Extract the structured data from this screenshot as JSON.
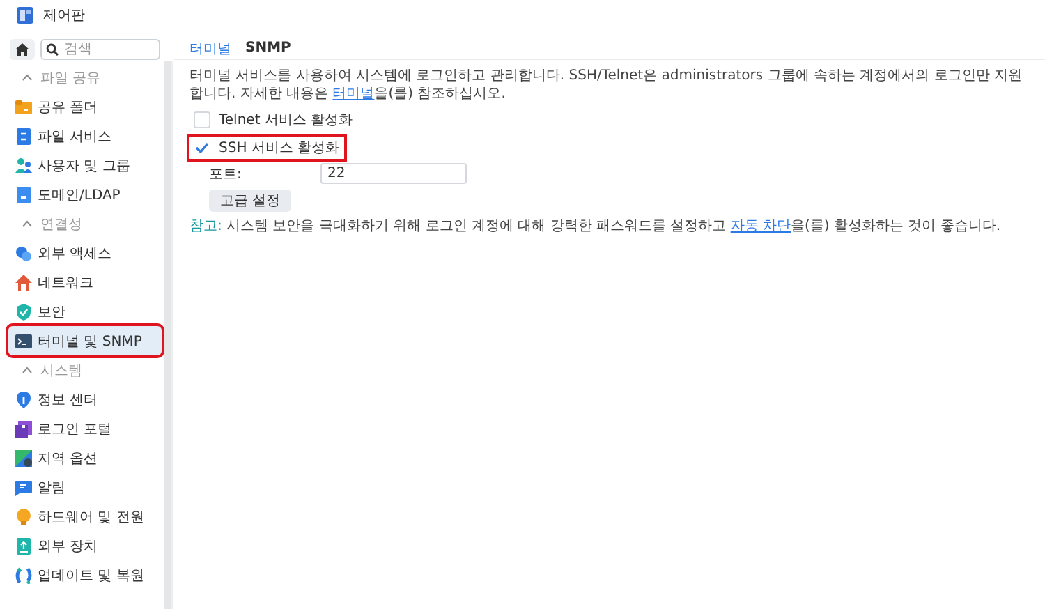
{
  "window": {
    "title": "제어판"
  },
  "sidebar": {
    "search": {
      "placeholder": "검색"
    },
    "sections": [
      {
        "title": "파일 공유",
        "expanded": true,
        "items": [
          {
            "label": "공유 폴더",
            "selected": false,
            "highlighted": false
          },
          {
            "label": "파일 서비스",
            "selected": false,
            "highlighted": false
          },
          {
            "label": "사용자 및 그룹",
            "selected": false,
            "highlighted": false
          },
          {
            "label": "도메인/LDAP",
            "selected": false,
            "highlighted": false
          }
        ]
      },
      {
        "title": "연결성",
        "expanded": true,
        "items": [
          {
            "label": "외부 액세스",
            "selected": false,
            "highlighted": false
          },
          {
            "label": "네트워크",
            "selected": false,
            "highlighted": false
          },
          {
            "label": "보안",
            "selected": false,
            "highlighted": false
          },
          {
            "label": "터미널 및 SNMP",
            "selected": true,
            "highlighted": true
          }
        ]
      },
      {
        "title": "시스템",
        "expanded": true,
        "items": [
          {
            "label": "정보 센터",
            "selected": false,
            "highlighted": false
          },
          {
            "label": "로그인 포털",
            "selected": false,
            "highlighted": false
          },
          {
            "label": "지역 옵션",
            "selected": false,
            "highlighted": false
          },
          {
            "label": "알림",
            "selected": false,
            "highlighted": false
          },
          {
            "label": "하드웨어 및 전원",
            "selected": false,
            "highlighted": false
          },
          {
            "label": "외부 장치",
            "selected": false,
            "highlighted": false
          },
          {
            "label": "업데이트 및 복원",
            "selected": false,
            "highlighted": false
          }
        ]
      }
    ]
  },
  "tabs": [
    {
      "label": "터미널",
      "selected": true
    },
    {
      "label": "SNMP",
      "selected": false
    }
  ],
  "description": {
    "before": "터미널 서비스를 사용하여 시스템에 로그인하고 관리합니다. SSH/Telnet은 administrators 그룹에 속하는 계정에서의 로그인만 지원합니다. 자세한 내용은 ",
    "link": "터미널",
    "after": "을(를) 참조하십시오."
  },
  "options": [
    {
      "label": "Telnet 서비스 활성화",
      "checked": false,
      "highlighted": false
    },
    {
      "label": "SSH 서비스 활성화",
      "checked": true,
      "highlighted": true
    }
  ],
  "port": {
    "label": "포트:",
    "value": "22"
  },
  "advanced_button": "고급 설정",
  "note": {
    "label": "참고:",
    "before": " 시스템 보안을 극대화하기 위해 로그인 계정에 대해 강력한 패스워드를 설정하고 ",
    "link": "자동 차단",
    "after": "을(를) 활성화하는 것이 좋습니다."
  }
}
